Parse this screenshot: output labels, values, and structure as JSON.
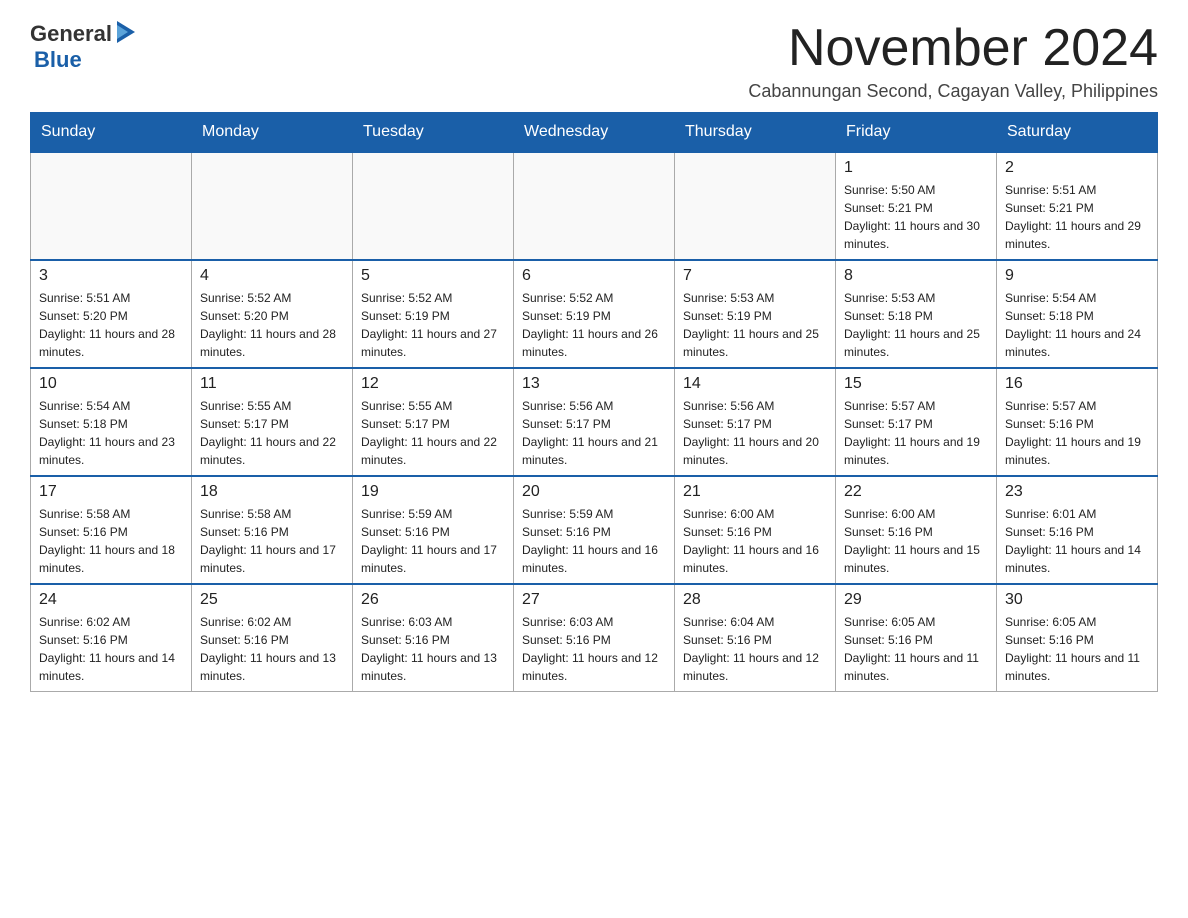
{
  "logo": {
    "text_general": "General",
    "text_blue": "Blue"
  },
  "header": {
    "month_title": "November 2024",
    "location": "Cabannungan Second, Cagayan Valley, Philippines"
  },
  "days_of_week": [
    "Sunday",
    "Monday",
    "Tuesday",
    "Wednesday",
    "Thursday",
    "Friday",
    "Saturday"
  ],
  "weeks": [
    [
      {
        "day": "",
        "sunrise": "",
        "sunset": "",
        "daylight": ""
      },
      {
        "day": "",
        "sunrise": "",
        "sunset": "",
        "daylight": ""
      },
      {
        "day": "",
        "sunrise": "",
        "sunset": "",
        "daylight": ""
      },
      {
        "day": "",
        "sunrise": "",
        "sunset": "",
        "daylight": ""
      },
      {
        "day": "",
        "sunrise": "",
        "sunset": "",
        "daylight": ""
      },
      {
        "day": "1",
        "sunrise": "Sunrise: 5:50 AM",
        "sunset": "Sunset: 5:21 PM",
        "daylight": "Daylight: 11 hours and 30 minutes."
      },
      {
        "day": "2",
        "sunrise": "Sunrise: 5:51 AM",
        "sunset": "Sunset: 5:21 PM",
        "daylight": "Daylight: 11 hours and 29 minutes."
      }
    ],
    [
      {
        "day": "3",
        "sunrise": "Sunrise: 5:51 AM",
        "sunset": "Sunset: 5:20 PM",
        "daylight": "Daylight: 11 hours and 28 minutes."
      },
      {
        "day": "4",
        "sunrise": "Sunrise: 5:52 AM",
        "sunset": "Sunset: 5:20 PM",
        "daylight": "Daylight: 11 hours and 28 minutes."
      },
      {
        "day": "5",
        "sunrise": "Sunrise: 5:52 AM",
        "sunset": "Sunset: 5:19 PM",
        "daylight": "Daylight: 11 hours and 27 minutes."
      },
      {
        "day": "6",
        "sunrise": "Sunrise: 5:52 AM",
        "sunset": "Sunset: 5:19 PM",
        "daylight": "Daylight: 11 hours and 26 minutes."
      },
      {
        "day": "7",
        "sunrise": "Sunrise: 5:53 AM",
        "sunset": "Sunset: 5:19 PM",
        "daylight": "Daylight: 11 hours and 25 minutes."
      },
      {
        "day": "8",
        "sunrise": "Sunrise: 5:53 AM",
        "sunset": "Sunset: 5:18 PM",
        "daylight": "Daylight: 11 hours and 25 minutes."
      },
      {
        "day": "9",
        "sunrise": "Sunrise: 5:54 AM",
        "sunset": "Sunset: 5:18 PM",
        "daylight": "Daylight: 11 hours and 24 minutes."
      }
    ],
    [
      {
        "day": "10",
        "sunrise": "Sunrise: 5:54 AM",
        "sunset": "Sunset: 5:18 PM",
        "daylight": "Daylight: 11 hours and 23 minutes."
      },
      {
        "day": "11",
        "sunrise": "Sunrise: 5:55 AM",
        "sunset": "Sunset: 5:17 PM",
        "daylight": "Daylight: 11 hours and 22 minutes."
      },
      {
        "day": "12",
        "sunrise": "Sunrise: 5:55 AM",
        "sunset": "Sunset: 5:17 PM",
        "daylight": "Daylight: 11 hours and 22 minutes."
      },
      {
        "day": "13",
        "sunrise": "Sunrise: 5:56 AM",
        "sunset": "Sunset: 5:17 PM",
        "daylight": "Daylight: 11 hours and 21 minutes."
      },
      {
        "day": "14",
        "sunrise": "Sunrise: 5:56 AM",
        "sunset": "Sunset: 5:17 PM",
        "daylight": "Daylight: 11 hours and 20 minutes."
      },
      {
        "day": "15",
        "sunrise": "Sunrise: 5:57 AM",
        "sunset": "Sunset: 5:17 PM",
        "daylight": "Daylight: 11 hours and 19 minutes."
      },
      {
        "day": "16",
        "sunrise": "Sunrise: 5:57 AM",
        "sunset": "Sunset: 5:16 PM",
        "daylight": "Daylight: 11 hours and 19 minutes."
      }
    ],
    [
      {
        "day": "17",
        "sunrise": "Sunrise: 5:58 AM",
        "sunset": "Sunset: 5:16 PM",
        "daylight": "Daylight: 11 hours and 18 minutes."
      },
      {
        "day": "18",
        "sunrise": "Sunrise: 5:58 AM",
        "sunset": "Sunset: 5:16 PM",
        "daylight": "Daylight: 11 hours and 17 minutes."
      },
      {
        "day": "19",
        "sunrise": "Sunrise: 5:59 AM",
        "sunset": "Sunset: 5:16 PM",
        "daylight": "Daylight: 11 hours and 17 minutes."
      },
      {
        "day": "20",
        "sunrise": "Sunrise: 5:59 AM",
        "sunset": "Sunset: 5:16 PM",
        "daylight": "Daylight: 11 hours and 16 minutes."
      },
      {
        "day": "21",
        "sunrise": "Sunrise: 6:00 AM",
        "sunset": "Sunset: 5:16 PM",
        "daylight": "Daylight: 11 hours and 16 minutes."
      },
      {
        "day": "22",
        "sunrise": "Sunrise: 6:00 AM",
        "sunset": "Sunset: 5:16 PM",
        "daylight": "Daylight: 11 hours and 15 minutes."
      },
      {
        "day": "23",
        "sunrise": "Sunrise: 6:01 AM",
        "sunset": "Sunset: 5:16 PM",
        "daylight": "Daylight: 11 hours and 14 minutes."
      }
    ],
    [
      {
        "day": "24",
        "sunrise": "Sunrise: 6:02 AM",
        "sunset": "Sunset: 5:16 PM",
        "daylight": "Daylight: 11 hours and 14 minutes."
      },
      {
        "day": "25",
        "sunrise": "Sunrise: 6:02 AM",
        "sunset": "Sunset: 5:16 PM",
        "daylight": "Daylight: 11 hours and 13 minutes."
      },
      {
        "day": "26",
        "sunrise": "Sunrise: 6:03 AM",
        "sunset": "Sunset: 5:16 PM",
        "daylight": "Daylight: 11 hours and 13 minutes."
      },
      {
        "day": "27",
        "sunrise": "Sunrise: 6:03 AM",
        "sunset": "Sunset: 5:16 PM",
        "daylight": "Daylight: 11 hours and 12 minutes."
      },
      {
        "day": "28",
        "sunrise": "Sunrise: 6:04 AM",
        "sunset": "Sunset: 5:16 PM",
        "daylight": "Daylight: 11 hours and 12 minutes."
      },
      {
        "day": "29",
        "sunrise": "Sunrise: 6:05 AM",
        "sunset": "Sunset: 5:16 PM",
        "daylight": "Daylight: 11 hours and 11 minutes."
      },
      {
        "day": "30",
        "sunrise": "Sunrise: 6:05 AM",
        "sunset": "Sunset: 5:16 PM",
        "daylight": "Daylight: 11 hours and 11 minutes."
      }
    ]
  ]
}
